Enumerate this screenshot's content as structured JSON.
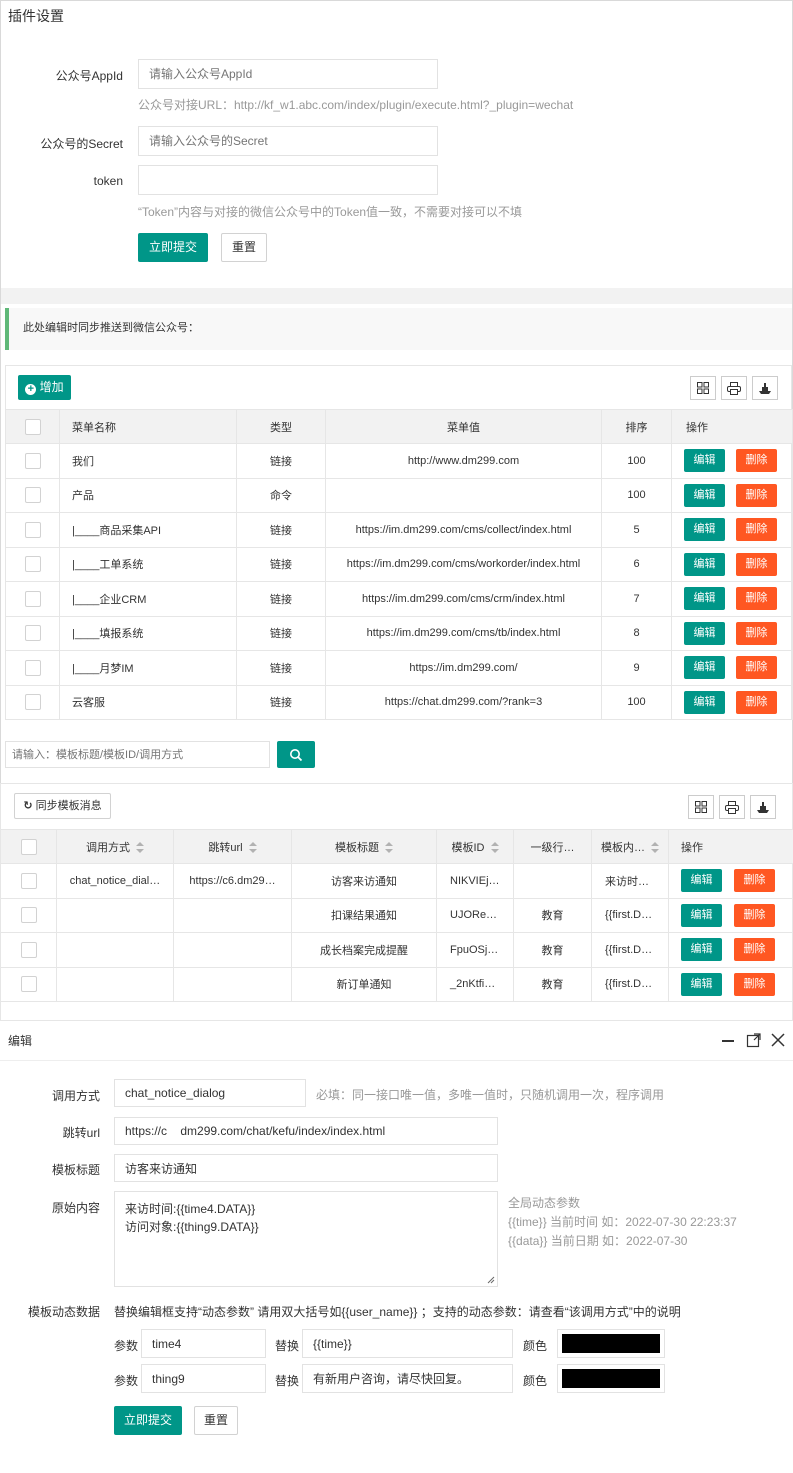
{
  "plugin": {
    "title": "插件设置",
    "appid_label": "公众号AppId",
    "appid_placeholder": "请输入公众号AppId",
    "appid_hint": "公众号对接URL：http://kf_w1.abc.com/index/plugin/execute.html?_plugin=wechat",
    "secret_label": "公众号的Secret",
    "secret_placeholder": "请输入公众号的Secret",
    "token_label": "token",
    "token_value": "",
    "token_hint": "“Token”内容与对接的微信公众号中的Token值一致，不需要对接可以不填",
    "submit": "立即提交",
    "reset": "重置"
  },
  "notice": "此处编辑时同步推送到微信公众号：",
  "menu_table": {
    "add_label": "增加",
    "columns": [
      "菜单名称",
      "类型",
      "菜单值",
      "排序",
      "操作"
    ],
    "rows": [
      {
        "name": "我们",
        "type": "链接",
        "value": "http://www.dm299.com",
        "sort": "100"
      },
      {
        "name": "产品",
        "type": "命令",
        "value": "",
        "sort": "100"
      },
      {
        "name": "|____商品采集API",
        "type": "链接",
        "value": "https://im.dm299.com/cms/collect/index.html",
        "sort": "5"
      },
      {
        "name": "|____工单系统",
        "type": "链接",
        "value": "https://im.dm299.com/cms/workorder/index.html",
        "sort": "6"
      },
      {
        "name": "|____企业CRM",
        "type": "链接",
        "value": "https://im.dm299.com/cms/crm/index.html",
        "sort": "7"
      },
      {
        "name": "|____填报系统",
        "type": "链接",
        "value": "https://im.dm299.com/cms/tb/index.html",
        "sort": "8"
      },
      {
        "name": "|____月梦IM",
        "type": "链接",
        "value": "https://im.dm299.com/",
        "sort": "9"
      },
      {
        "name": "云客服",
        "type": "链接",
        "value": "https://chat.dm299.com/?rank=3",
        "sort": "100"
      }
    ],
    "edit": "编辑",
    "delete": "删除"
  },
  "search": {
    "placeholder": "请输入：模板标题/模板ID/调用方式"
  },
  "tpl_table": {
    "sync_label": "同步模板消息",
    "columns": [
      "调用方式",
      "跳转url",
      "模板标题",
      "模板ID",
      "一级行…",
      "模板内…",
      "操作"
    ],
    "rows": [
      {
        "method": "chat_notice_dial…",
        "url": "https://c6.dm29…",
        "title": "访客来访通知",
        "id": "NIKVIEj…",
        "industry": "",
        "content": "来访时…"
      },
      {
        "method": "",
        "url": "",
        "title": "扣课结果通知",
        "id": "UJORe…",
        "industry": "教育",
        "content": "{{first.D…"
      },
      {
        "method": "",
        "url": "",
        "title": "成长档案完成提醒",
        "id": "FpuOSj…",
        "industry": "教育",
        "content": "{{first.D…"
      },
      {
        "method": "",
        "url": "",
        "title": "新订单通知",
        "id": "_2nKtfi…",
        "industry": "教育",
        "content": "{{first.D…"
      }
    ],
    "edit": "编辑",
    "delete": "删除"
  },
  "dialog": {
    "title": "编辑",
    "method_label": "调用方式",
    "method_value": "chat_notice_dialog",
    "method_hint": "必填：同一接口唯一值，多唯一值时，只随机调用一次，程序调用",
    "url_label": "跳转url",
    "url_value": "https://c    dm299.com/chat/kefu/index/index.html",
    "title_label": "模板标题",
    "title_value": "访客来访通知",
    "content_label": "原始内容",
    "content_line1": "来访时间:{{time4.DATA}}",
    "content_line2": "访问对象:{{thing9.DATA}}",
    "global_title": "全局动态参数",
    "global_line1": "{{time}} 当前时间 如：2022-07-30 22:23:37",
    "global_line2": "{{data}} 当前日期 如：2022-07-30",
    "dyn_label": "模板动态数据",
    "dyn_hint": "替换编辑框支持“动态参数” 请用双大括号如{{user_name}} ；支持的动态参数：请查看“该调用方式”中的说明",
    "param_label": "参数",
    "replace_label": "替换",
    "color_label": "颜色",
    "params": [
      {
        "param": "time4",
        "replace": "{{time}}",
        "color": "#000000"
      },
      {
        "param": "thing9",
        "replace": "有新用户咨询，请尽快回复。",
        "color": "#000000"
      }
    ],
    "submit": "立即提交",
    "reset": "重置"
  }
}
